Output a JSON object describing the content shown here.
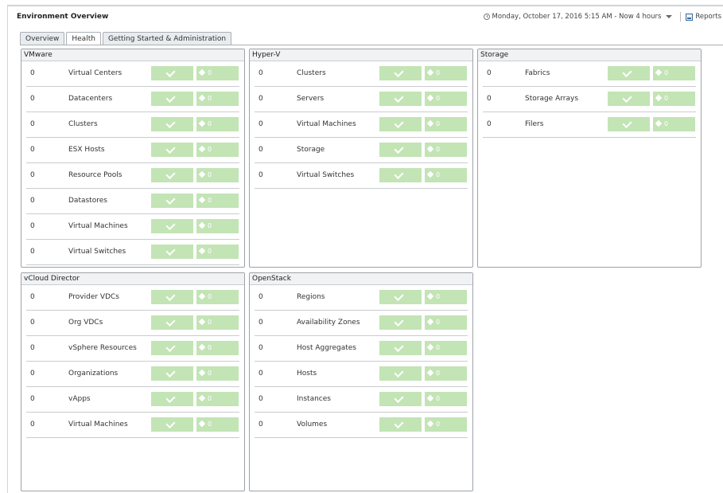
{
  "header": {
    "title": "Environment Overview",
    "time_range": "Monday, October 17, 2016 5:15 AM - Now 4 hours",
    "reports_label": "Reports"
  },
  "tabs": [
    {
      "label": "Overview"
    },
    {
      "label": "Health"
    },
    {
      "label": "Getting Started & Administration"
    }
  ],
  "colors": {
    "status_ok": "#c3e4b5",
    "border": "#9da3aa"
  },
  "panels": {
    "vmware": {
      "title": "VMware",
      "rows": [
        {
          "count": "0",
          "label": "Virtual Centers",
          "warnings": "0"
        },
        {
          "count": "0",
          "label": "Datacenters",
          "warnings": "0"
        },
        {
          "count": "0",
          "label": "Clusters",
          "warnings": "0"
        },
        {
          "count": "0",
          "label": "ESX Hosts",
          "warnings": "0"
        },
        {
          "count": "0",
          "label": "Resource Pools",
          "warnings": "0"
        },
        {
          "count": "0",
          "label": "Datastores",
          "warnings": "0"
        },
        {
          "count": "0",
          "label": "Virtual Machines",
          "warnings": "0"
        },
        {
          "count": "0",
          "label": "Virtual Switches",
          "warnings": "0"
        }
      ]
    },
    "hyperv": {
      "title": "Hyper-V",
      "rows": [
        {
          "count": "0",
          "label": "Clusters",
          "warnings": "0"
        },
        {
          "count": "0",
          "label": "Servers",
          "warnings": "0"
        },
        {
          "count": "0",
          "label": "Virtual Machines",
          "warnings": "0"
        },
        {
          "count": "0",
          "label": "Storage",
          "warnings": "0"
        },
        {
          "count": "0",
          "label": "Virtual Switches",
          "warnings": "0"
        }
      ]
    },
    "storage": {
      "title": "Storage",
      "rows": [
        {
          "count": "0",
          "label": "Fabrics",
          "warnings": "0"
        },
        {
          "count": "0",
          "label": "Storage Arrays",
          "warnings": "0"
        },
        {
          "count": "0",
          "label": "Filers",
          "warnings": "0"
        }
      ]
    },
    "vcloud": {
      "title": "vCloud Director",
      "rows": [
        {
          "count": "0",
          "label": "Provider VDCs",
          "warnings": "0"
        },
        {
          "count": "0",
          "label": "Org VDCs",
          "warnings": "0"
        },
        {
          "count": "0",
          "label": "vSphere Resources",
          "warnings": "0"
        },
        {
          "count": "0",
          "label": "Organizations",
          "warnings": "0"
        },
        {
          "count": "0",
          "label": "vApps",
          "warnings": "0"
        },
        {
          "count": "0",
          "label": "Virtual Machines",
          "warnings": "0"
        }
      ]
    },
    "openstack": {
      "title": "OpenStack",
      "rows": [
        {
          "count": "0",
          "label": "Regions",
          "warnings": "0"
        },
        {
          "count": "0",
          "label": "Availability Zones",
          "warnings": "0"
        },
        {
          "count": "0",
          "label": "Host Aggregates",
          "warnings": "0"
        },
        {
          "count": "0",
          "label": "Hosts",
          "warnings": "0"
        },
        {
          "count": "0",
          "label": "Instances",
          "warnings": "0"
        },
        {
          "count": "0",
          "label": "Volumes",
          "warnings": "0"
        }
      ]
    }
  }
}
